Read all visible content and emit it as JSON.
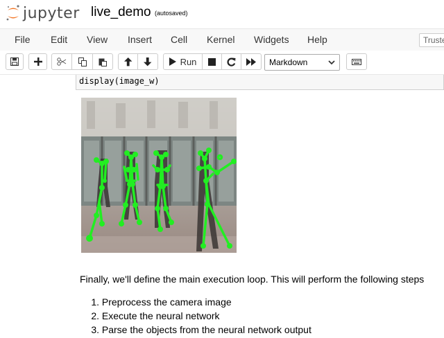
{
  "header": {
    "logo_text": "jupyter",
    "notebook_name": "live_demo",
    "autosave_status": "(autosaved)"
  },
  "menubar": {
    "items": [
      "File",
      "Edit",
      "View",
      "Insert",
      "Cell",
      "Kernel",
      "Widgets",
      "Help"
    ],
    "trusted_label": "Truste"
  },
  "toolbar": {
    "run_label": "Run",
    "cell_type": "Markdown",
    "buttons": [
      "save-icon",
      "plus-icon",
      "cut-icon",
      "copy-icon",
      "paste-icon",
      "arrow-up-icon",
      "arrow-down-icon",
      "run-icon",
      "stop-icon",
      "restart-icon",
      "fast-forward-icon",
      "keyboard-icon"
    ]
  },
  "cells": {
    "code": "display(image_w)",
    "markdown_paragraph": "Finally, we'll define the main execution loop. This will perform the following steps",
    "list": [
      {
        "num": "1.",
        "text": "Preprocess the camera image"
      },
      {
        "num": "2.",
        "text": "Execute the neural network"
      },
      {
        "num": "3.",
        "text": "Parse the objects from the neural network output"
      }
    ]
  },
  "colors": {
    "skeleton": "#22ee22",
    "menubar_bg": "#f8f8f8",
    "logo_orange": "#f37726"
  }
}
